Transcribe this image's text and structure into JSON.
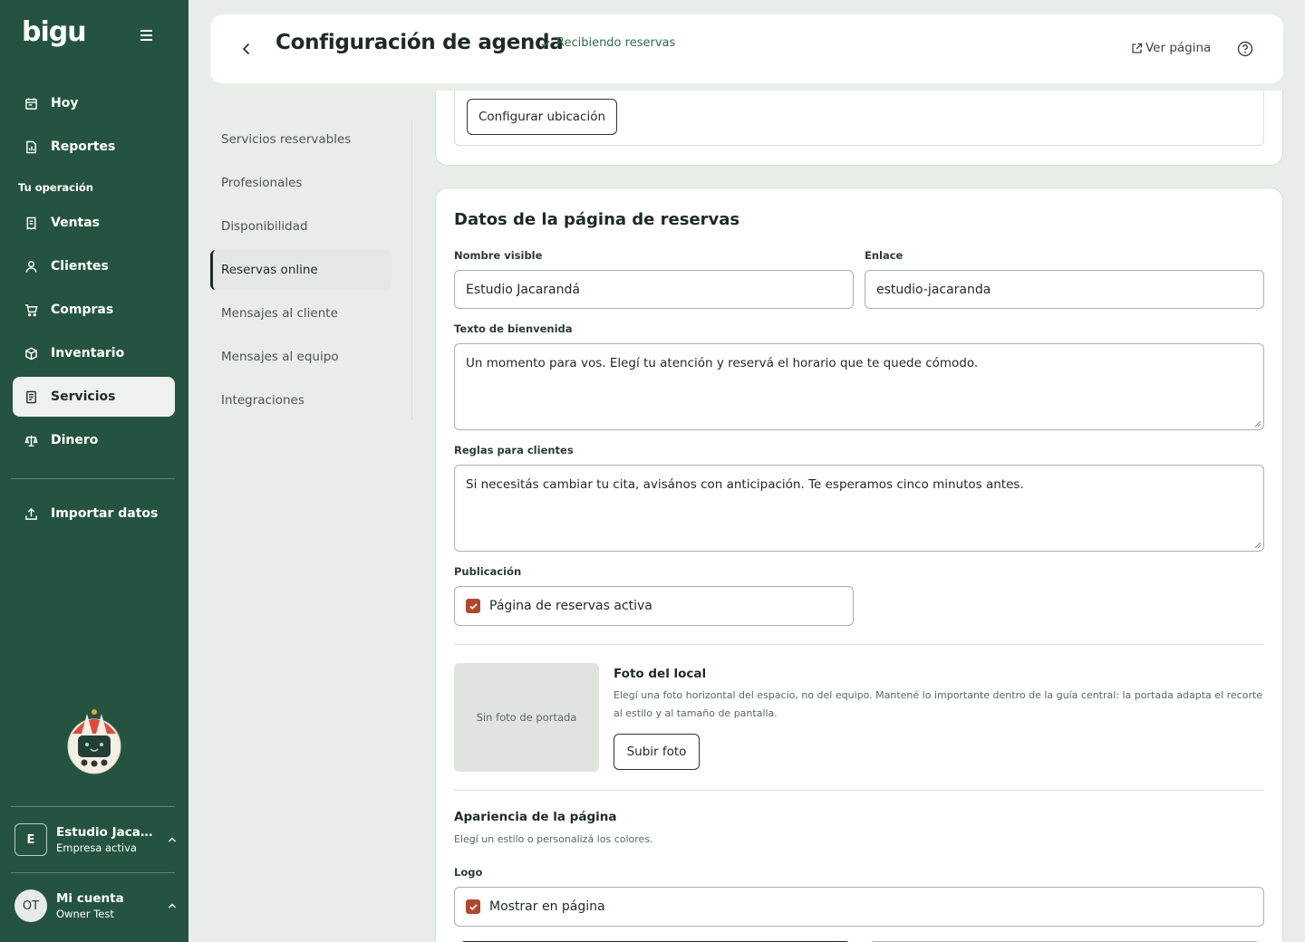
{
  "app": {
    "logo": "bigu"
  },
  "sidebar": {
    "items_top": [
      {
        "label": "Hoy",
        "icon": "calendar-icon"
      },
      {
        "label": "Reportes",
        "icon": "report-icon"
      }
    ],
    "section_label": "Tu operación",
    "items_ops": [
      {
        "label": "Ventas",
        "icon": "receipt-icon"
      },
      {
        "label": "Clientes",
        "icon": "user-icon"
      },
      {
        "label": "Compras",
        "icon": "cart-icon"
      },
      {
        "label": "Inventario",
        "icon": "box-icon"
      },
      {
        "label": "Servicios",
        "icon": "document-icon",
        "active": true
      },
      {
        "label": "Dinero",
        "icon": "scale-icon"
      }
    ],
    "import_label": "Importar datos",
    "company": {
      "initial": "E",
      "name": "Estudio Jacara...",
      "status": "Empresa activa"
    },
    "account": {
      "initials": "OT",
      "name": "Mi cuenta",
      "user": "Owner Test"
    }
  },
  "header": {
    "title": "Configuración de agenda",
    "status": "Recibiendo reservas",
    "view_page": "Ver página"
  },
  "subnav": {
    "items": [
      "Servicios reservables",
      "Profesionales",
      "Disponibilidad",
      "Reservas online",
      "Mensajes al cliente",
      "Mensajes al equipo",
      "Integraciones"
    ],
    "active": "Reservas online"
  },
  "location": {
    "button": "Configurar ubicación"
  },
  "booking": {
    "title": "Datos de la página de reservas",
    "visible_name_label": "Nombre visible",
    "visible_name_value": "Estudio Jacarandá",
    "link_label": "Enlace",
    "link_value": "estudio-jacaranda",
    "welcome_label": "Texto de bienvenida",
    "welcome_value": "Un momento para vos. Elegí tu atención y reservá el horario que te quede cómodo.",
    "rules_label": "Reglas para clientes",
    "rules_value": "Si necesitás cambiar tu cita, avisános con anticipación. Te esperamos cinco minutos antes.",
    "publication_label": "Publicación",
    "publication_checkbox": "Página de reservas activa",
    "photo_placeholder": "Sin foto de portada",
    "photo_title": "Foto del local",
    "photo_desc": "Elegí una foto horizontal del espacio, no del equipo. Mantené lo importante dentro de la guía central: la portada adapta el recorte al estilo y al tamaño de pantalla.",
    "photo_button": "Subir foto",
    "appearance_title": "Apariencia de la página",
    "appearance_desc": "Elegí un estilo o personalizá los colores.",
    "logo_label": "Logo",
    "logo_checkbox": "Mostrar en página"
  },
  "colors": {
    "sidebar": "#245440",
    "accent_check": "#b0482e",
    "status_green": "#2e6b4b"
  }
}
